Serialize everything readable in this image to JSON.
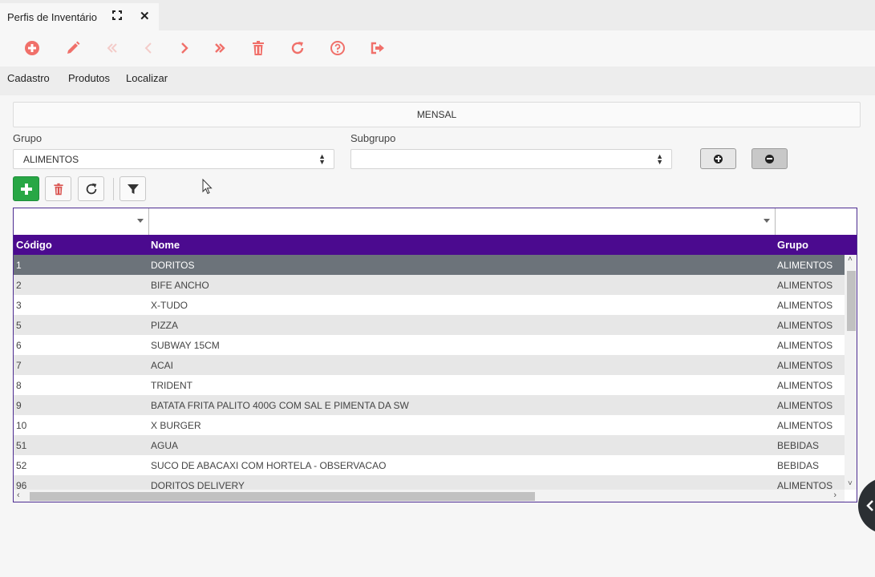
{
  "tab": {
    "title": "Perfis de Inventário",
    "close": "✕"
  },
  "toolbar": {
    "icons": [
      "plus-circle-icon",
      "pencil-icon",
      "first-icon",
      "prev-icon",
      "next-icon",
      "last-icon",
      "trash-icon",
      "refresh-icon",
      "help-icon",
      "exit-icon"
    ],
    "accent": "#f0706a"
  },
  "menu": {
    "items": [
      "Cadastro",
      "Produtos",
      "Localizar"
    ]
  },
  "form": {
    "title": "MENSAL",
    "grupo_label": "Grupo",
    "grupo_value": "ALIMENTOS",
    "subgrupo_label": "Subgrupo",
    "subgrupo_value": ""
  },
  "grid": {
    "header_color": "#4b0a8f",
    "columns": [
      "Código",
      "Nome",
      "Grupo"
    ],
    "rows": [
      {
        "codigo": "1",
        "nome": "DORITOS",
        "grupo": "ALIMENTOS"
      },
      {
        "codigo": "2",
        "nome": "BIFE ANCHO",
        "grupo": "ALIMENTOS"
      },
      {
        "codigo": "3",
        "nome": "X-TUDO",
        "grupo": "ALIMENTOS"
      },
      {
        "codigo": "5",
        "nome": "PIZZA",
        "grupo": "ALIMENTOS"
      },
      {
        "codigo": "6",
        "nome": "SUBWAY 15CM",
        "grupo": "ALIMENTOS"
      },
      {
        "codigo": "7",
        "nome": "ACAI",
        "grupo": "ALIMENTOS"
      },
      {
        "codigo": "8",
        "nome": "TRIDENT",
        "grupo": "ALIMENTOS"
      },
      {
        "codigo": "9",
        "nome": "BATATA FRITA PALITO 400G COM SAL E PIMENTA DA SW",
        "grupo": "ALIMENTOS"
      },
      {
        "codigo": "10",
        "nome": "X BURGER",
        "grupo": "ALIMENTOS"
      },
      {
        "codigo": "51",
        "nome": "AGUA",
        "grupo": "BEBIDAS"
      },
      {
        "codigo": "52",
        "nome": "SUCO DE ABACAXI COM HORTELA - OBSERVACAO",
        "grupo": "BEBIDAS"
      },
      {
        "codigo": "96",
        "nome": "DORITOS DELIVERY",
        "grupo": "ALIMENTOS"
      }
    ],
    "selected_index": 0
  }
}
